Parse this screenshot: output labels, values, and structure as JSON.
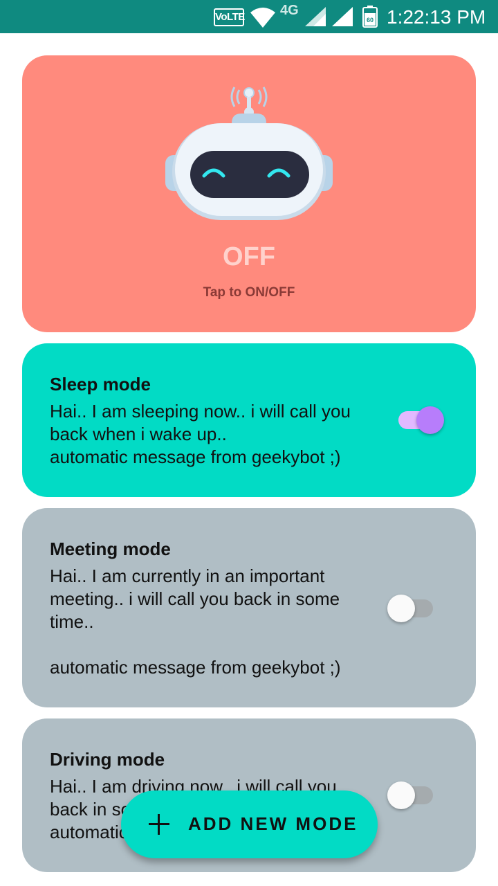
{
  "status_bar": {
    "volte": "VoLTE",
    "network": "4G",
    "battery_level": "60",
    "time": "1:22:13 PM"
  },
  "bot": {
    "state": "OFF",
    "hint": "Tap to ON/OFF",
    "icon": "robot-icon"
  },
  "modes": [
    {
      "title": "Sleep mode",
      "message": "Hai.. I am sleeping now.. i will call you back when i wake up..\nautomatic message from geekybot ;)",
      "enabled": true
    },
    {
      "title": "Meeting mode",
      "message": "Hai.. I am currently in an important meeting.. i will call you back in some time..\n\nautomatic message from geekybot ;)",
      "enabled": false
    },
    {
      "title": "Driving mode",
      "message": "Hai.. I am driving now.. i will call you back in some time..\nautomatic message from geekybot ;)",
      "enabled": false
    }
  ],
  "fab": {
    "label": "ADD NEW MODE",
    "icon": "plus-icon"
  },
  "colors": {
    "status_bar": "#0f8a80",
    "bot_card_off": "#ff8a7d",
    "active_card": "#02dbc5",
    "inactive_card": "#b0bec5",
    "switch_on": "#b77dfb"
  }
}
